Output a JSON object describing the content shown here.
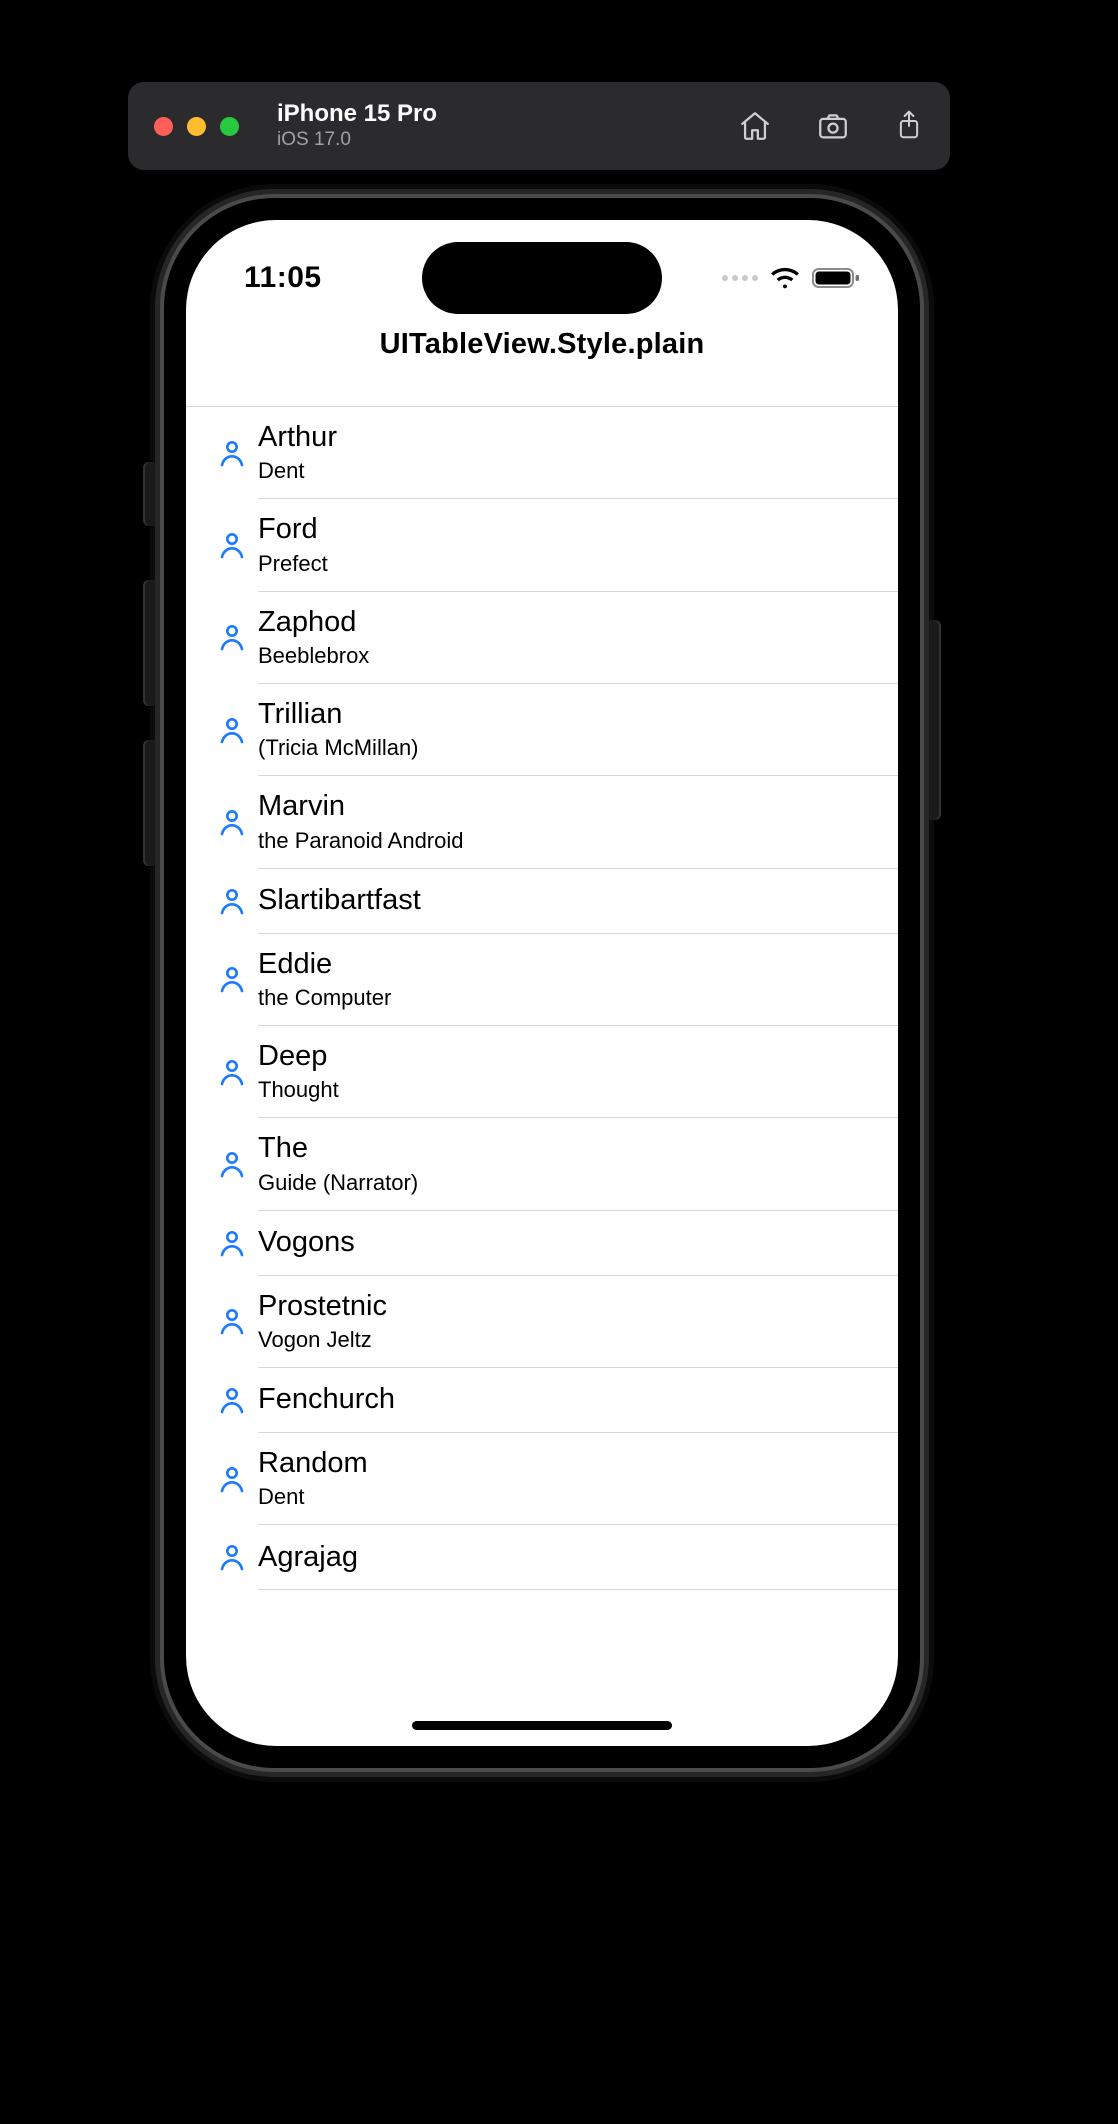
{
  "host": {
    "device_name": "iPhone 15 Pro",
    "os_version": "iOS 17.0"
  },
  "status": {
    "time": "11:05"
  },
  "nav": {
    "title": "UITableView.Style.plain"
  },
  "contacts": [
    {
      "first": "Arthur",
      "last": "Dent"
    },
    {
      "first": "Ford",
      "last": "Prefect"
    },
    {
      "first": "Zaphod",
      "last": "Beeblebrox"
    },
    {
      "first": "Trillian",
      "last": "(Tricia McMillan)"
    },
    {
      "first": "Marvin",
      "last": "the Paranoid Android"
    },
    {
      "first": "Slartibartfast",
      "last": ""
    },
    {
      "first": "Eddie",
      "last": "the Computer"
    },
    {
      "first": "Deep",
      "last": "Thought"
    },
    {
      "first": "The",
      "last": "Guide (Narrator)"
    },
    {
      "first": "Vogons",
      "last": ""
    },
    {
      "first": "Prostetnic",
      "last": "Vogon Jeltz"
    },
    {
      "first": "Fenchurch",
      "last": ""
    },
    {
      "first": "Random",
      "last": "Dent"
    },
    {
      "first": "Agrajag",
      "last": ""
    }
  ]
}
